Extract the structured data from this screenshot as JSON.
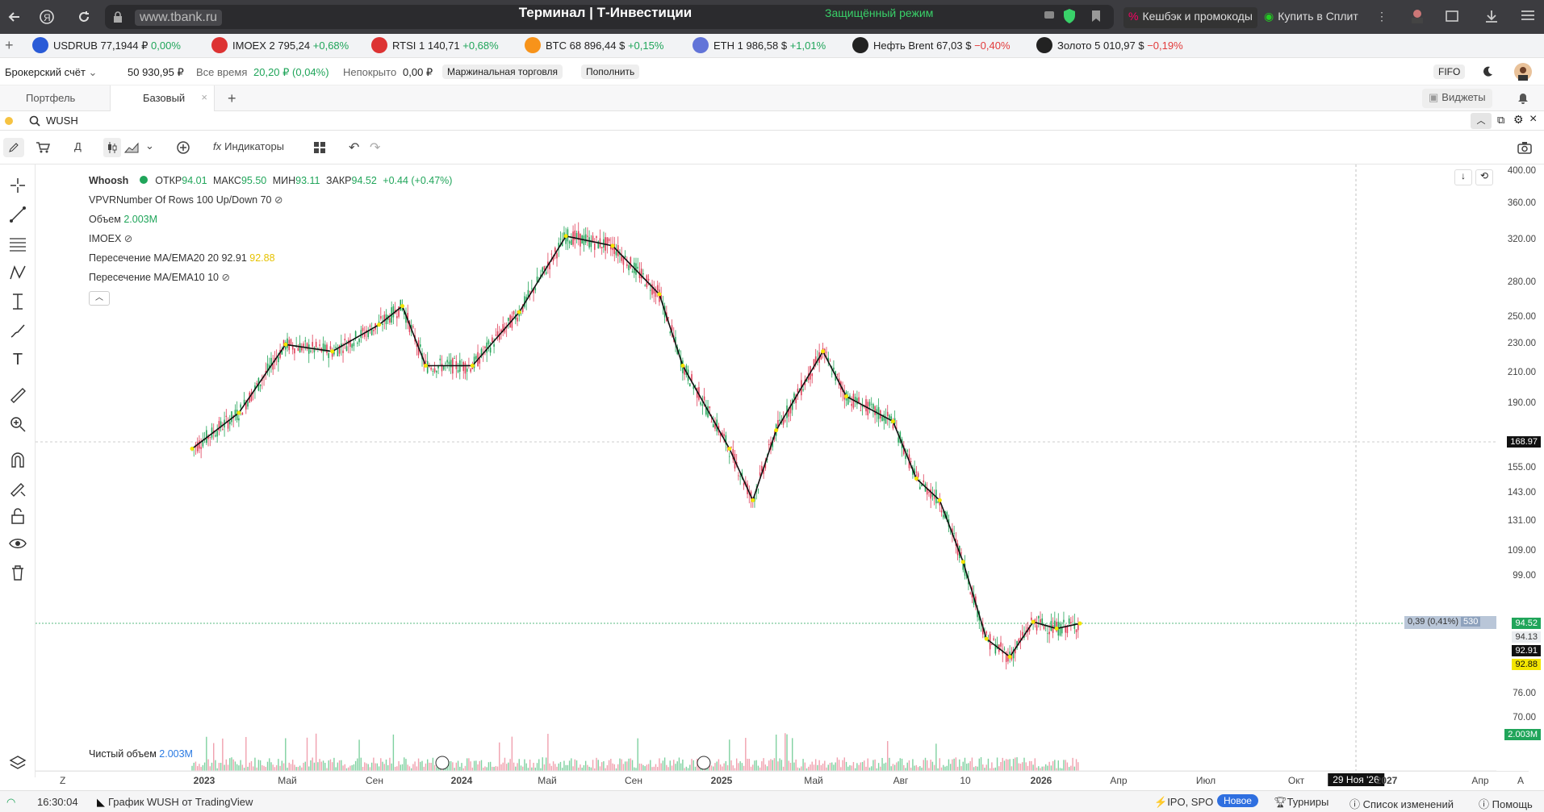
{
  "browser": {
    "url": "www.tbank.ru",
    "title": "Терминал | Т-Инвестиции",
    "secure": "Защищённый режим",
    "cashback": "Кешбэк и промокоды",
    "split": "Купить в Сплит"
  },
  "ticker": [
    {
      "name": "USDRUB",
      "price": "77,1944 ₽",
      "change": "0,00%",
      "dir": "pos",
      "color": "#2a5bd7"
    },
    {
      "name": "IMOEX",
      "price": "2 795,24",
      "change": "+0,68%",
      "dir": "pos",
      "color": "#d33"
    },
    {
      "name": "RTSI",
      "price": "1 140,71",
      "change": "+0,68%",
      "dir": "pos",
      "color": "#d33"
    },
    {
      "name": "BTC",
      "price": "68 896,44 $",
      "change": "+0,15%",
      "dir": "pos",
      "color": "#f7931a"
    },
    {
      "name": "ETH",
      "price": "1 986,58 $",
      "change": "+1,01%",
      "dir": "pos",
      "color": "#6274d8"
    },
    {
      "name": "Нефть Brent",
      "price": "67,03 $",
      "change": "−0,40%",
      "dir": "neg",
      "color": "#222"
    },
    {
      "name": "Золото",
      "price": "5 010,97 $",
      "change": "−0,19%",
      "dir": "neg",
      "color": "#222"
    }
  ],
  "account": {
    "name": "Брокерский счёт",
    "balance": "50 930,95 ₽",
    "alltime_label": "Все время",
    "alltime_value": "20,20 ₽ (0,04%)",
    "uncovered_label": "Непокрыто",
    "uncovered_value": "0,00 ₽",
    "margin": "Маржинальная торговля",
    "topup": "Пополнить",
    "fifo": "FIFO"
  },
  "tabs": {
    "portfolio": "Портфель",
    "base": "Базовый",
    "widgets": "Виджеты"
  },
  "search": {
    "ticker": "WUSH"
  },
  "toolbar": {
    "d": "Д",
    "indicators": "Индикаторы"
  },
  "legend": {
    "name": "Whoosh",
    "o_label": "ОТКР",
    "o": "94.01",
    "h_label": "МАКС",
    "h": "95.50",
    "l_label": "МИН",
    "l": "93.11",
    "c_label": "ЗАКР",
    "c": "94.52",
    "chg": "+0.44 (+0.47%)",
    "vpvr": "VPVRNumber Of Rows 100 Up/Down 70",
    "vol_label": "Объем",
    "vol": "2.003M",
    "imoex": "IMOEX",
    "ma20": "Пересечение MA/EMA20 20",
    "ma20_a": "92.91",
    "ma20_b": "92.88",
    "ma10": "Пересечение MA/EMA10 10"
  },
  "netvol": {
    "label": "Чистый объем",
    "value": "2.003M"
  },
  "yaxis": [
    "400.00",
    "360.00",
    "320.00",
    "280.00",
    "250.00",
    "230.00",
    "210.00",
    "190.00",
    "155.00",
    "143.00",
    "131.00",
    "109.00",
    "99.00",
    "76.00",
    "70.00"
  ],
  "price_labels": {
    "cross": "168.97",
    "last": "94.52",
    "p2": "94.13",
    "p3": "92.91",
    "p4": "92.88",
    "vol": "2.003M",
    "pnl": "0,39 (0,41%)",
    "qty": "530"
  },
  "xaxis": [
    "2023",
    "Май",
    "Сен",
    "2024",
    "Май",
    "Сен",
    "2025",
    "Май",
    "Авг",
    "10",
    "2026",
    "Апр",
    "Июл",
    "Окт",
    "29 Ноя '26",
    "2027",
    "Апр"
  ],
  "xaxis_corner": {
    "left": "Z",
    "right": "A"
  },
  "status": {
    "time": "16:30:04",
    "source": "График WUSH от TradingView",
    "ipo": "IPO, SPO",
    "new": "Новое",
    "tournaments": "Турниры",
    "changelog": "Список изменений",
    "help": "Помощь"
  },
  "chart_data": {
    "type": "candlestick",
    "symbol": "WUSH",
    "name": "Whoosh",
    "ylim": [
      70,
      400
    ],
    "y_scale": "log",
    "approx_close": [
      {
        "x": "2022-12",
        "y": 165
      },
      {
        "x": "2023-02",
        "y": 185
      },
      {
        "x": "2023-04",
        "y": 230
      },
      {
        "x": "2023-06",
        "y": 225
      },
      {
        "x": "2023-08",
        "y": 245
      },
      {
        "x": "2023-09",
        "y": 260
      },
      {
        "x": "2023-10",
        "y": 215
      },
      {
        "x": "2023-12",
        "y": 215
      },
      {
        "x": "2024-02",
        "y": 255
      },
      {
        "x": "2024-04",
        "y": 325
      },
      {
        "x": "2024-06",
        "y": 315
      },
      {
        "x": "2024-08",
        "y": 270
      },
      {
        "x": "2024-09",
        "y": 215
      },
      {
        "x": "2024-11",
        "y": 165
      },
      {
        "x": "2024-12",
        "y": 140
      },
      {
        "x": "2025-01",
        "y": 175
      },
      {
        "x": "2025-03",
        "y": 225
      },
      {
        "x": "2025-04",
        "y": 195
      },
      {
        "x": "2025-06",
        "y": 180
      },
      {
        "x": "2025-07",
        "y": 150
      },
      {
        "x": "2025-08",
        "y": 140
      },
      {
        "x": "2025-09",
        "y": 115
      },
      {
        "x": "2025-10",
        "y": 90
      },
      {
        "x": "2025-11",
        "y": 85
      },
      {
        "x": "2025-12",
        "y": 95
      },
      {
        "x": "2026-01",
        "y": 93
      },
      {
        "x": "2026-02",
        "y": 94.52
      }
    ]
  }
}
